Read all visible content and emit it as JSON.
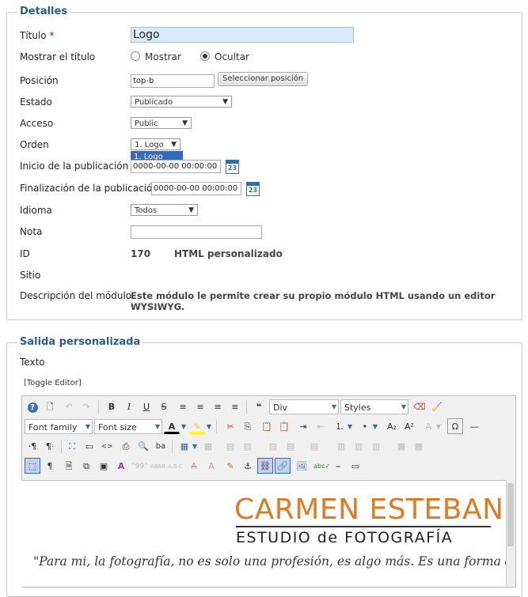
{
  "details": {
    "legend": "Detalles",
    "title_label": "Título",
    "title_required": "*",
    "title_value": "Logo",
    "show_title_label": "Mostrar el título",
    "show_option": "Mostrar",
    "hide_option": "Ocultar",
    "position_label": "Posición",
    "position_value": "top-b",
    "select_position_button": "Seleccionar posición",
    "status_label": "Estado",
    "status_value": "Publicado",
    "access_label": "Acceso",
    "access_value": "Public",
    "order_label": "Orden",
    "order_value": "1. Logo",
    "order_option_highlighted": "1. Logo",
    "publish_start_label": "Inicio de la publicación",
    "publish_start_value": "0000-00-00 00:00:00",
    "publish_end_label": "Finalización de la publicación",
    "publish_end_value": "0000-00-00 00:00:00",
    "calendar_day": "23",
    "language_label": "Idioma",
    "language_value": "Todos",
    "note_label": "Nota",
    "note_value": "",
    "id_label": "ID",
    "id_value": "170",
    "module_type": "HTML personalizado",
    "site_label": "Sitio",
    "description_label": "Descripción del módulo",
    "description_value": "Este módulo le permite crear su propio módulo HTML usando un editor WYSIWYG."
  },
  "custom_output": {
    "legend": "Salida personalizada",
    "text_label": "Texto",
    "toggle_editor": "[Toggle Editor]"
  },
  "toolbar": {
    "format_select": "Div",
    "styles_select": "Styles",
    "font_family_select": "Font family",
    "font_size_select": "Font size"
  },
  "editor_content": {
    "brand_name": "CARMEN ESTEBAN",
    "brand_subtitle": "ESTUDIO de FOTOGRAFÍA",
    "tagline": "\"Para mi, la fotografía, no es solo una profesión, es algo más. Es una forma de"
  },
  "colors": {
    "legend": "#2c5d8a",
    "brand_orange": "#e07b22",
    "highlight_blue": "#316ac5"
  }
}
